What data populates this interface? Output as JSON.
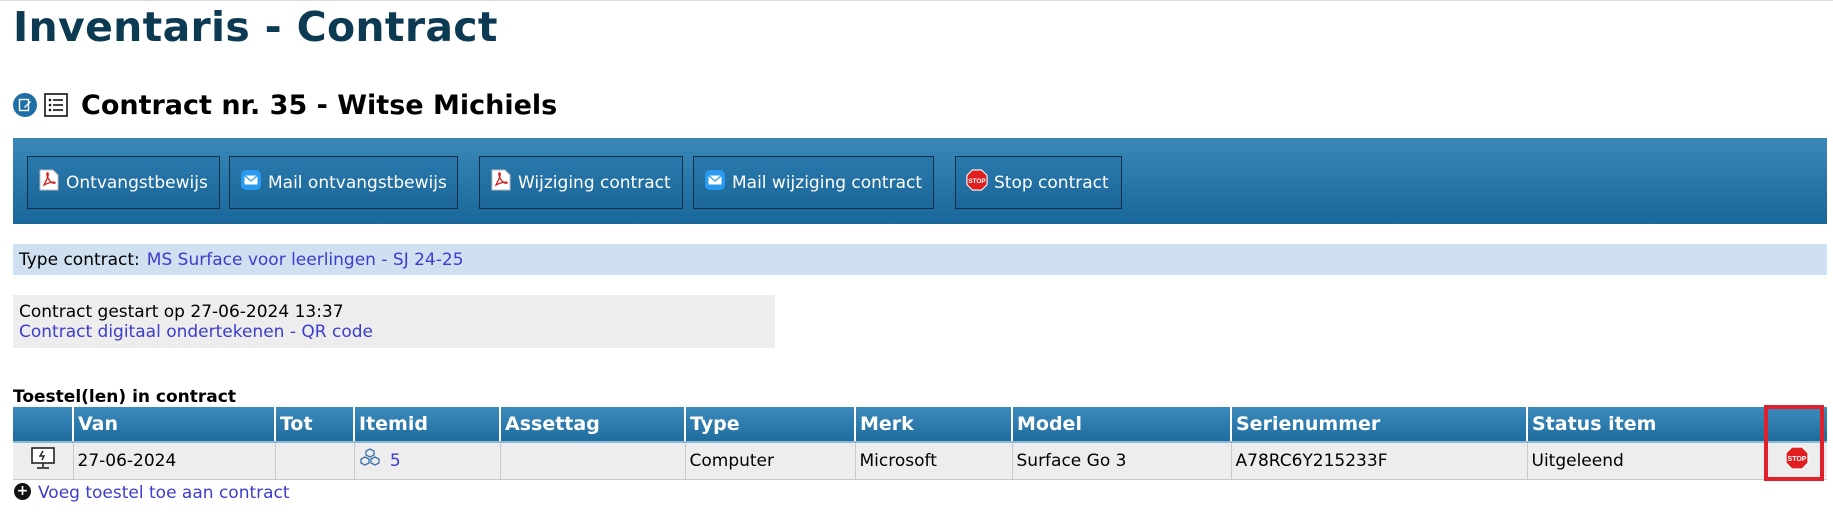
{
  "app_title": "Inventaris - Contract",
  "contract_heading": "Contract nr. 35 - Witse Michiels",
  "toolbar": {
    "buttons": [
      {
        "label": "Ontvangstbewijs",
        "icon": "pdf-icon"
      },
      {
        "label": "Mail ontvangstbewijs",
        "icon": "mail-icon"
      },
      {
        "label": "Wijziging contract",
        "icon": "pdf-icon"
      },
      {
        "label": "Mail wijziging contract",
        "icon": "mail-icon"
      },
      {
        "label": "Stop contract",
        "icon": "stop-icon"
      }
    ]
  },
  "type_contract": {
    "label": "Type contract:",
    "value": "MS Surface voor leerlingen - SJ 24-25"
  },
  "info": {
    "started": "Contract gestart op 27-06-2024 13:37",
    "sign_link": "Contract digitaal ondertekenen",
    "separator": "-",
    "qr_link": "QR code"
  },
  "devices_section": {
    "title": "Toestel(len) in contract",
    "columns": [
      "",
      "Van",
      "Tot",
      "Itemid",
      "Assettag",
      "Type",
      "Merk",
      "Model",
      "Serienummer",
      "Status item",
      ""
    ],
    "rows": [
      {
        "device_icon": "computer-icon",
        "van": "27-06-2024",
        "tot": "",
        "itemid": "5",
        "assettag": "",
        "type": "Computer",
        "merk": "Microsoft",
        "model": "Surface Go 3",
        "serienummer": "A78RC6Y215233F",
        "status": "Uitgeleend",
        "action_icon": "stop-icon"
      }
    ],
    "add_link": "Voeg toestel toe aan contract"
  },
  "colors": {
    "title": "#0d3a53",
    "toolbar": "#1f6c9f",
    "link": "#3c3ccf",
    "type_bar": "#cfe0f0",
    "highlight": "#e0202a"
  }
}
